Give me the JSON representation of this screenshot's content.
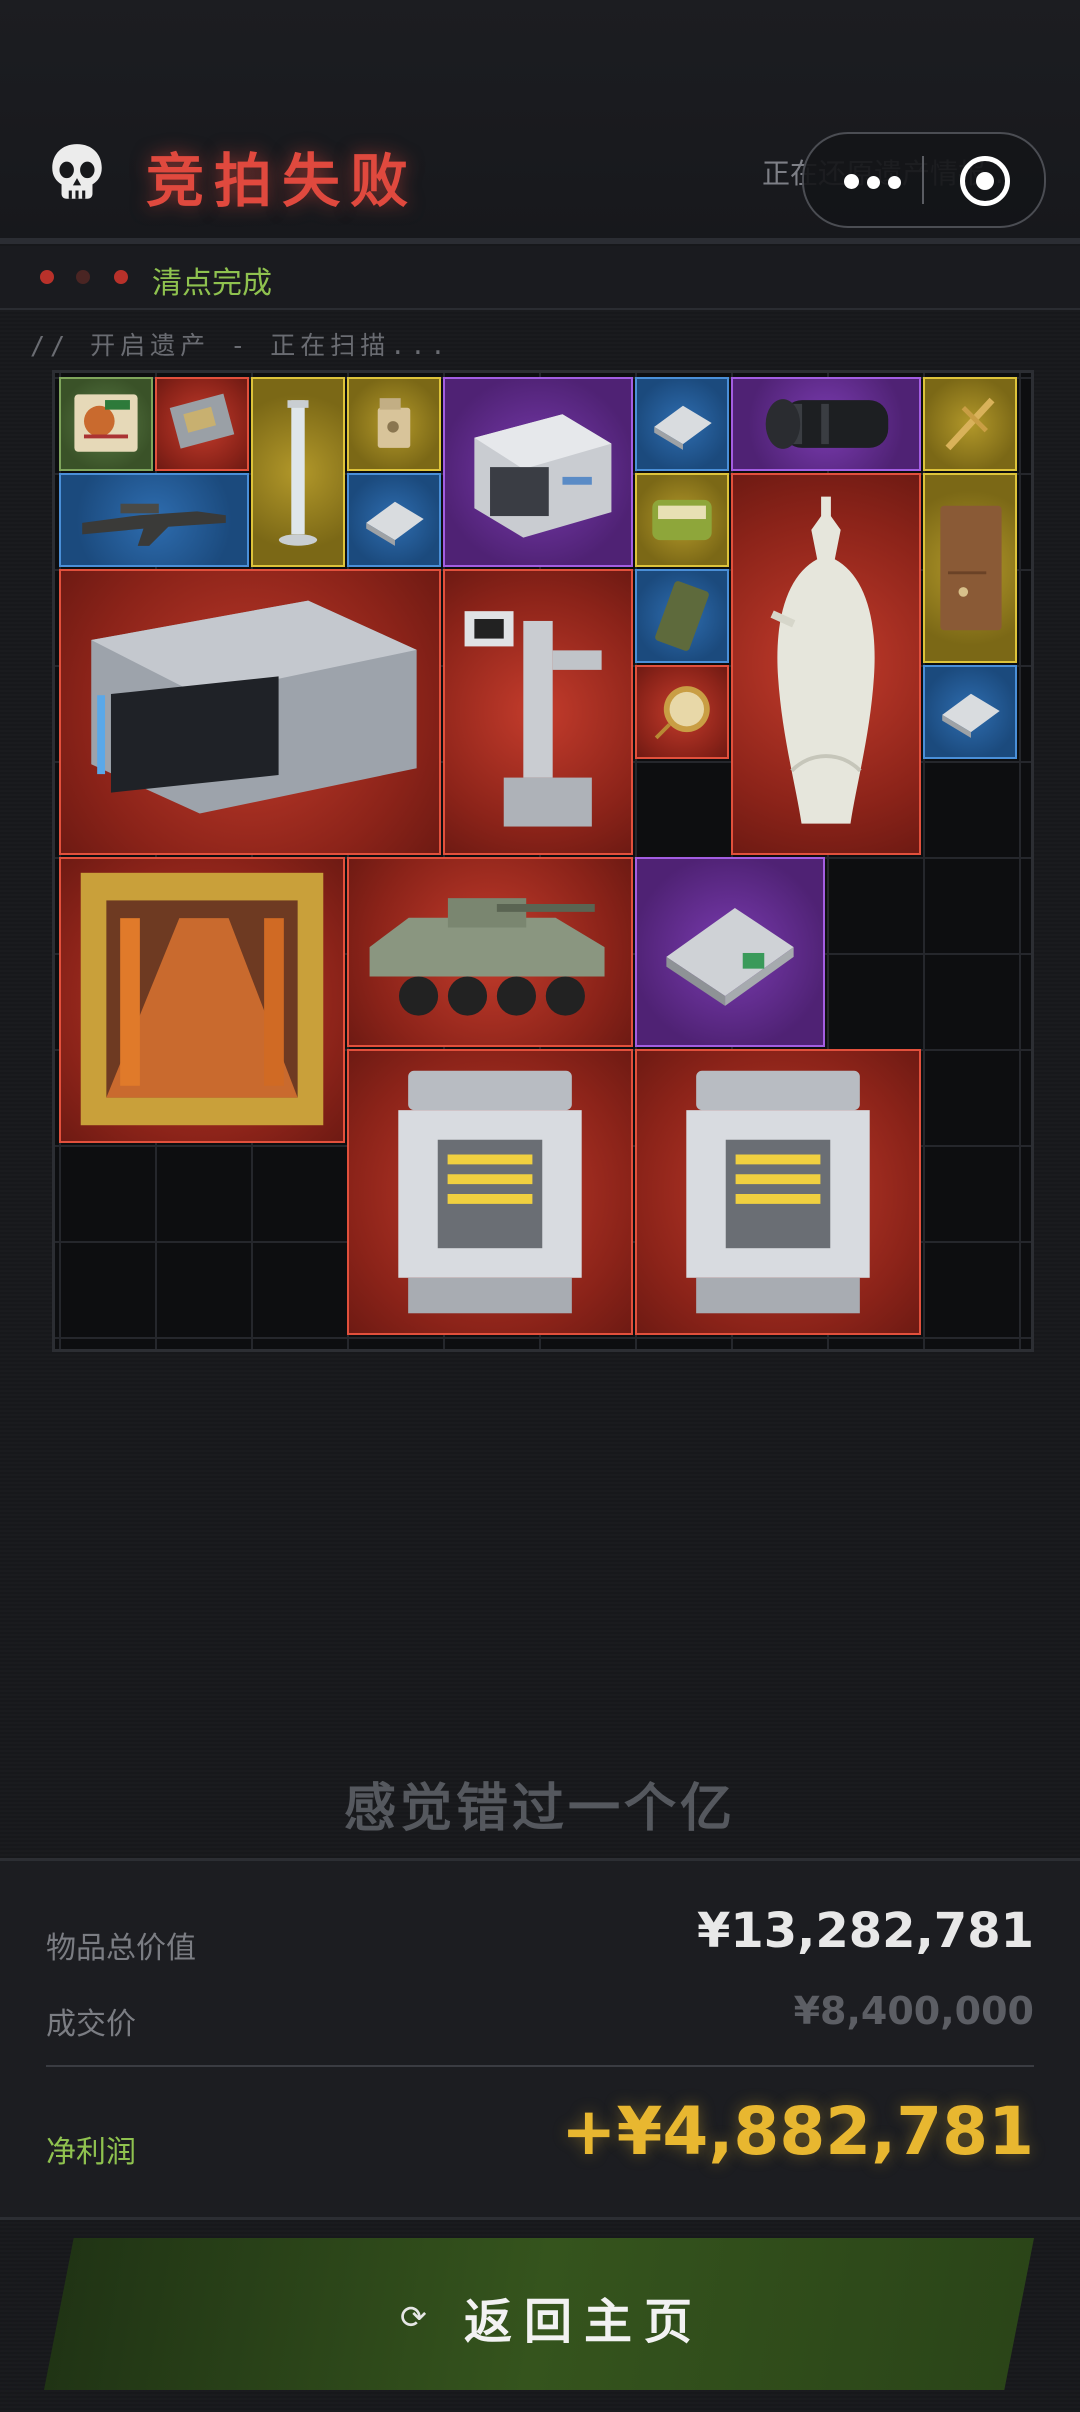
{
  "header": {
    "title": "竞拍失败",
    "restore_text": "正在还原遗产情报...",
    "skull_icon": "skull-icon"
  },
  "status": {
    "label": "清点完成",
    "dot_colors": [
      "#b8312a",
      "#4a2523",
      "#b8312a"
    ]
  },
  "scan_text": "// 开启遗产 - 正在扫描...",
  "items": [
    {
      "name": "instant-noodles",
      "rarity": "green"
    },
    {
      "name": "circuit-board",
      "rarity": "red"
    },
    {
      "name": "glass-tube",
      "rarity": "yellow"
    },
    {
      "name": "lighter",
      "rarity": "yellow"
    },
    {
      "name": "server-unit",
      "rarity": "purple"
    },
    {
      "name": "data-chip",
      "rarity": "blue"
    },
    {
      "name": "camera-lens",
      "rarity": "purple"
    },
    {
      "name": "golden-key",
      "rarity": "yellow"
    },
    {
      "name": "rifle",
      "rarity": "blue"
    },
    {
      "name": "data-chip",
      "rarity": "blue"
    },
    {
      "name": "canned-food",
      "rarity": "yellow"
    },
    {
      "name": "porcelain-vase",
      "rarity": "red"
    },
    {
      "name": "leather-notebook",
      "rarity": "yellow"
    },
    {
      "name": "server-rack",
      "rarity": "red"
    },
    {
      "name": "medical-robot",
      "rarity": "red"
    },
    {
      "name": "ration-pack",
      "rarity": "blue"
    },
    {
      "name": "pocket-watch",
      "rarity": "red"
    },
    {
      "name": "data-chip",
      "rarity": "blue"
    },
    {
      "name": "oil-painting",
      "rarity": "red"
    },
    {
      "name": "armored-vehicle",
      "rarity": "red"
    },
    {
      "name": "hard-drive",
      "rarity": "purple"
    },
    {
      "name": "reactor-core",
      "rarity": "red"
    },
    {
      "name": "reactor-core",
      "rarity": "red"
    }
  ],
  "rarity_colors": {
    "red": "#c43c2c",
    "blue": "#2e6db0",
    "purple": "#7a3bb0",
    "yellow": "#b2982a",
    "green": "#597a44"
  },
  "miss_text": "感觉错过一个亿",
  "summary": {
    "total_label": "物品总价值",
    "total_value": "¥13,282,781",
    "deal_label": "成交价",
    "deal_value": "¥8,400,000",
    "profit_label": "净利润",
    "profit_value": "+¥4,882,781"
  },
  "home_button": {
    "label": "返回主页",
    "icon": "refresh-icon"
  },
  "colors": {
    "accent_red": "#e0493e",
    "profit_gold": "#e8b730",
    "status_green": "#8fc24f"
  }
}
